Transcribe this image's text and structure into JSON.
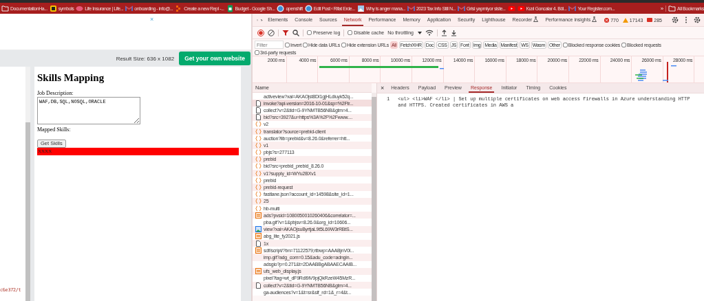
{
  "bookmarks": [
    {
      "kind": "folder",
      "label": "DocumentationHa..."
    },
    {
      "kind": "square",
      "label": "symbols"
    },
    {
      "kind": "blob",
      "label": "Life Insurance | Life..."
    },
    {
      "kind": "mail",
      "label": "onboarding - info@..."
    },
    {
      "kind": "repl",
      "label": "Create a new Repl -..."
    },
    {
      "kind": "sheet",
      "label": "Budget - Google Sh..."
    },
    {
      "kind": "globe",
      "label": "openshift"
    },
    {
      "kind": "globe",
      "label": "Edit Post ‹ Rifat Erde..."
    },
    {
      "kind": "picture",
      "label": "Why is anger mana..."
    },
    {
      "kind": "mail",
      "label": "2023 Tax Info Still N..."
    },
    {
      "kind": "mail",
      "label": "Grisi yapmiyor siste..."
    },
    {
      "kind": "video"
    },
    {
      "kind": "video",
      "label": "Kızıl Goncalar 4. Böl..."
    },
    {
      "kind": "mail",
      "label": "Your Register.com..."
    }
  ],
  "bookmarks_overflow": "»",
  "all_bookmarks": "All Bookmarks",
  "page": {
    "ad_close": "×",
    "result_size": "Result Size: 636 x 1082",
    "cta_button": "Get your own website",
    "code_fragment": "c6e372/t",
    "result": {
      "heading": "Skills Mapping",
      "job_label": "Job Description:",
      "job_value": "WAF,DB,SQL,NOSQL,ORACLE",
      "mapped_label": "Mapped Skills:",
      "button": "Get Skills",
      "output": "XXXX"
    }
  },
  "devtools": {
    "tabs": [
      {
        "label": "Elements",
        "selected": false,
        "experimental": false
      },
      {
        "label": "Console",
        "selected": false,
        "experimental": false
      },
      {
        "label": "Sources",
        "selected": false,
        "experimental": false
      },
      {
        "label": "Network",
        "selected": true,
        "experimental": false
      },
      {
        "label": "Performance",
        "selected": false,
        "experimental": false
      },
      {
        "label": "Memory",
        "selected": false,
        "experimental": false
      },
      {
        "label": "Application",
        "selected": false,
        "experimental": false
      },
      {
        "label": "Security",
        "selected": false,
        "experimental": false
      },
      {
        "label": "Lighthouse",
        "selected": false,
        "experimental": false
      },
      {
        "label": "Recorder",
        "selected": false,
        "experimental": true
      },
      {
        "label": "Performance insights",
        "selected": false,
        "experimental": true
      }
    ],
    "errors": "770",
    "warnings": "17143",
    "issues": "285",
    "toolbar": {
      "recording": true,
      "preserve_log": {
        "label": "Preserve log",
        "checked": false
      },
      "disable_cache": {
        "label": "Disable cache",
        "checked": false
      },
      "throttling": "No throttling"
    },
    "filter": {
      "placeholder": "Filter",
      "invert": {
        "label": "Invert",
        "checked": false
      },
      "hide_data": {
        "label": "Hide data URLs",
        "checked": false
      },
      "hide_ext": {
        "label": "Hide extension URLs",
        "checked": false
      },
      "types": [
        {
          "label": "All",
          "selected": true
        },
        {
          "label": "Fetch/XHR",
          "selected": false
        },
        {
          "label": "Doc",
          "selected": false
        },
        {
          "label": "CSS",
          "selected": false
        },
        {
          "label": "JS",
          "selected": false
        },
        {
          "label": "Font",
          "selected": false
        },
        {
          "label": "Img",
          "selected": false
        },
        {
          "label": "Media",
          "selected": false
        },
        {
          "label": "Manifest",
          "selected": false
        },
        {
          "label": "WS",
          "selected": false
        },
        {
          "label": "Wasm",
          "selected": false
        },
        {
          "label": "Other",
          "selected": false
        }
      ],
      "blocked_cookies": {
        "label": "Blocked response cookies",
        "checked": false
      },
      "blocked_requests": {
        "label": "Blocked requests",
        "checked": false
      },
      "third_party": {
        "label": "3rd-party requests",
        "checked": false
      }
    },
    "timeline_ticks": [
      "2000 ms",
      "4000 ms",
      "6000 ms",
      "8000 ms",
      "10000 ms",
      "12000 ms",
      "14000 ms",
      "16000 ms",
      "18000 ms",
      "20000 ms",
      "22000 ms",
      "24000 ms",
      "26000 ms",
      "28000 ms"
    ],
    "name_header": "Name",
    "requests": [
      {
        "kind": "none",
        "name": "activeview?xai=AKAOjst8DI1gjHLdiuyk52q...",
        "selected": false
      },
      {
        "kind": "doc",
        "name": "invoke?api-version=2016-10-01&sp=%2Ftr...",
        "selected": true
      },
      {
        "kind": "doc",
        "name": "collect?v=2&tid=G-9YNMTB56NB&gtm=4...",
        "selected": false
      },
      {
        "kind": "doc",
        "name": "bid?src=3927&u=https%3A%2F%2Fwww....",
        "selected": false
      },
      {
        "kind": "fetch",
        "name": "v2",
        "selected": false
      },
      {
        "kind": "fetch",
        "name": "translator?source=prebid-client",
        "selected": false
      },
      {
        "kind": "fetch",
        "name": "auction?lib=prebid&v=8.26.0&referrer=htt...",
        "selected": false
      },
      {
        "kind": "fetch",
        "name": "v1",
        "selected": false
      },
      {
        "kind": "fetch",
        "name": "pbjs?s=277113",
        "selected": false
      },
      {
        "kind": "fetch",
        "name": "prebid",
        "selected": false
      },
      {
        "kind": "fetch",
        "name": "bid?src=prebid_prebid_8.26.0",
        "selected": false
      },
      {
        "kind": "fetch",
        "name": "v1?supply_id=WYu2BXv1",
        "selected": false
      },
      {
        "kind": "fetch",
        "name": "prebid",
        "selected": false
      },
      {
        "kind": "fetch",
        "name": "prebid-request",
        "selected": false
      },
      {
        "kind": "fetch",
        "name": "fastlane.json?account_id=14598&site_id=1...",
        "selected": false
      },
      {
        "kind": "fetch",
        "name": "25",
        "selected": false
      },
      {
        "kind": "fetch",
        "name": "hb-multi",
        "selected": false
      },
      {
        "kind": "script",
        "name": "ads?pvsid=1080050010260406&correlator=...",
        "selected": false
      },
      {
        "kind": "none",
        "name": "pba.gif?v=1&pbjsv=8.26.0&org_id=10606...",
        "selected": false
      },
      {
        "kind": "image",
        "name": "view?xai=AKAOjsuByrtjaL9t5L69W3rRBtS...",
        "selected": false
      },
      {
        "kind": "script",
        "name": "abg_lite_fy2021.js",
        "selected": false
      },
      {
        "kind": "doc",
        "name": "1x",
        "selected": false
      },
      {
        "kind": "script",
        "name": "sdf/script/?bn=71122579;rtbwp=AAABjnV0l...",
        "selected": false
      },
      {
        "kind": "none",
        "name": "imp.gif?adg_com=0.15&adu_code=adngin...",
        "selected": false
      },
      {
        "kind": "none",
        "name": "adsgio?p=0.271&t=2DAABBgABAAECAAIB...",
        "selected": false
      },
      {
        "kind": "script",
        "name": "ufs_web_display.js",
        "selected": false
      },
      {
        "kind": "none",
        "name": "pixel?tag=wt_dF9Rdl9iV9pjQkRzeW45MzR...",
        "selected": false
      },
      {
        "kind": "doc",
        "name": "collect?v=2&tid=G-9YNMTB56NB&gtm=4...",
        "selected": false
      },
      {
        "kind": "none",
        "name": "ga-audiences?v=1&t=sr&slf_rd=1&_r=4&t...",
        "selected": false
      }
    ],
    "detail_close": "×",
    "detail_tabs": [
      {
        "label": "Headers",
        "selected": false
      },
      {
        "label": "Payload",
        "selected": false
      },
      {
        "label": "Preview",
        "selected": false
      },
      {
        "label": "Response",
        "selected": true
      },
      {
        "label": "Initiator",
        "selected": false
      },
      {
        "label": "Timing",
        "selected": false
      },
      {
        "label": "Cookies",
        "selected": false
      }
    ],
    "response_lines": [
      {
        "number": "1",
        "text": "<ul> <li>WAF </li> | Set up multiple certificates on web access firewalls in Azure understanding HTTP and HTTPS. Created certificates in AWS a"
      }
    ]
  }
}
